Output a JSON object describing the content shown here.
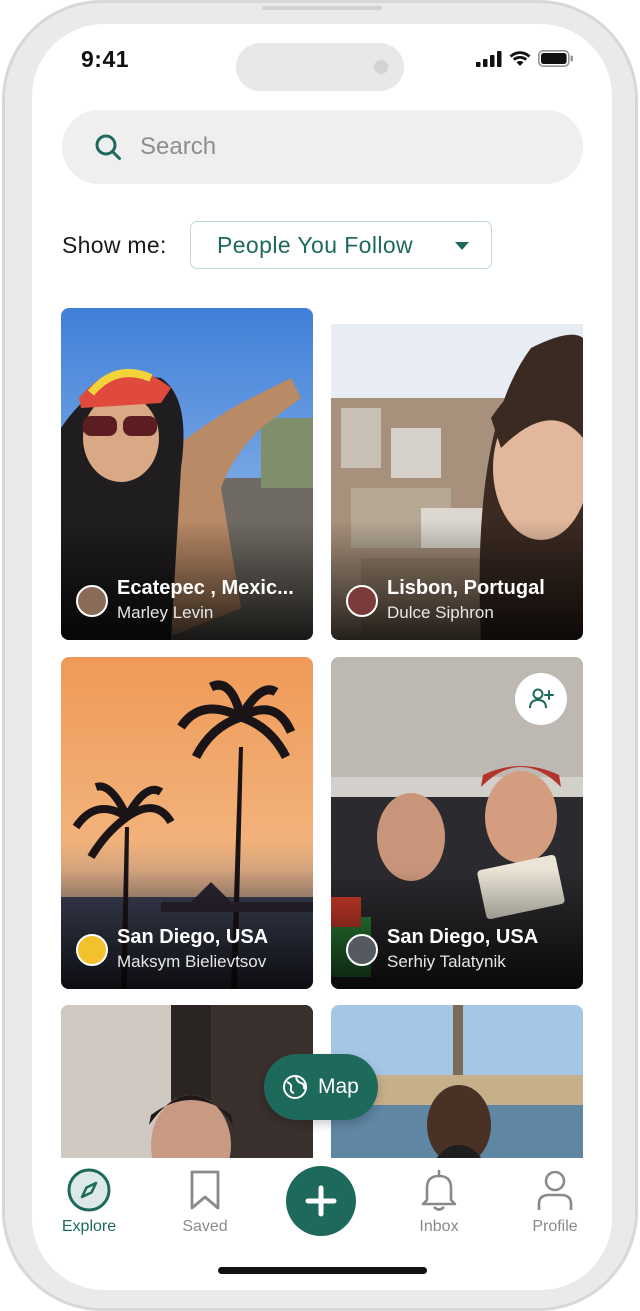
{
  "status": {
    "time": "9:41"
  },
  "search": {
    "placeholder": "Search"
  },
  "filter": {
    "label": "Show me:",
    "value": "People You Follow"
  },
  "cards": [
    {
      "place": "Ecatepec , Mexic...",
      "person": "Marley Levin"
    },
    {
      "place": "Lisbon, Portugal",
      "person": "Dulce Siphron"
    },
    {
      "place": "San Diego, USA",
      "person": "Maksym Bielievtsov"
    },
    {
      "place": "San Diego, USA",
      "person": "Serhiy Talatynik"
    }
  ],
  "map_button": {
    "label": "Map"
  },
  "tabs": [
    {
      "label": "Explore",
      "icon": "compass-icon"
    },
    {
      "label": "Saved",
      "icon": "bookmark-icon"
    },
    {
      "label": "Inbox",
      "icon": "bell-icon"
    },
    {
      "label": "Profile",
      "icon": "person-icon"
    }
  ],
  "colors": {
    "accent": "#1d6a5c",
    "filter_border": "#bfd9d3",
    "search_bg": "#efefef"
  }
}
